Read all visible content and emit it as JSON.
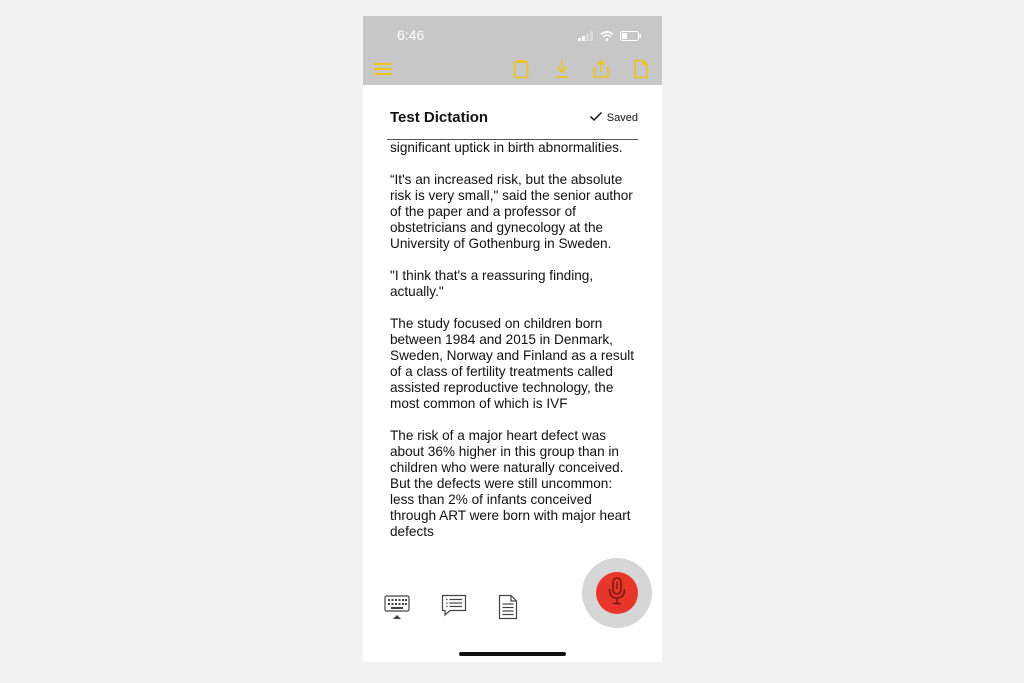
{
  "status_bar": {
    "time": "6:46"
  },
  "toolbar": {
    "icons": [
      "menu-icon",
      "clipboard-icon",
      "download-icon",
      "share-icon",
      "document-icon"
    ],
    "accent_color": "#f0c419"
  },
  "document": {
    "title": "Test Dictation",
    "saved_label": "Saved",
    "paragraphs": [
      "significant uptick in birth abnormalities.",
      "“It's an increased risk, but the absolute risk is very small,\" said the senior author of the paper and a professor of obstetricians and gynecology at the University of Gothenburg in Sweden.",
      "\"I think that's a reassuring finding, actually.\"",
      "The study focused on children born between 1984 and 2015 in Denmark, Sweden, Norway and Finland as a result of a class of fertility treatments called assisted reproductive technology, the most common of which is IVF",
      "The risk of a major heart defect was about 36% higher in this group than in children who were naturally conceived. But the defects were still uncommon: less than 2% of infants conceived through ART were born with major heart defects"
    ]
  },
  "bottom_bar": {
    "icons": [
      "keyboard-icon",
      "comment-icon",
      "document-list-icon"
    ],
    "mic_color": "#e8362a"
  }
}
